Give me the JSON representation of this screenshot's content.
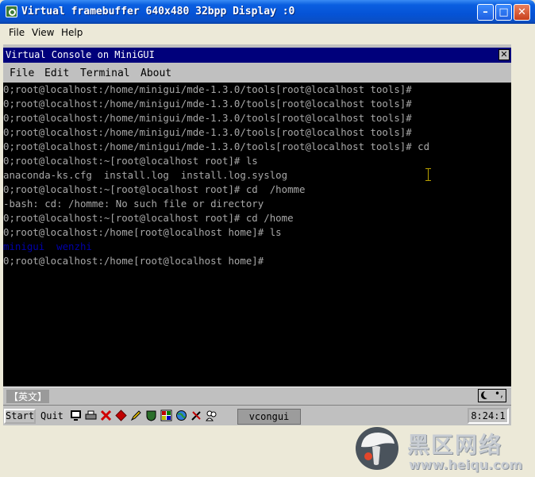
{
  "window": {
    "title": "Virtual framebuffer 640x480 32bpp Display :0",
    "minimize_glyph": "–",
    "maximize_glyph": "□",
    "close_glyph": "✕"
  },
  "menubar": {
    "items": [
      "File",
      "View",
      "Help"
    ]
  },
  "console": {
    "title": "Virtual Console on MiniGUI",
    "close_glyph": "✕",
    "menu": [
      "File",
      "Edit",
      "Terminal",
      "About"
    ],
    "lines": [
      "0;root@localhost:/home/minigui/mde-1.3.0/tools[root@localhost tools]#",
      "0;root@localhost:/home/minigui/mde-1.3.0/tools[root@localhost tools]#",
      "0;root@localhost:/home/minigui/mde-1.3.0/tools[root@localhost tools]#",
      "0;root@localhost:/home/minigui/mde-1.3.0/tools[root@localhost tools]#",
      "0;root@localhost:/home/minigui/mde-1.3.0/tools[root@localhost tools]# cd",
      "0;root@localhost:~[root@localhost root]# ls",
      "anaconda-ks.cfg  install.log  install.log.syslog",
      "0;root@localhost:~[root@localhost root]# cd  /homme",
      "-bash: cd: /homme: No such file or directory",
      "0;root@localhost:~[root@localhost root]# cd /home",
      "0;root@localhost:/home[root@localhost home]# ls",
      "minigui  wenzhi",
      "0;root@localhost:/home[root@localhost home]#"
    ],
    "dir_color": "#0000AA",
    "text_color": "#A8A8A8"
  },
  "ime": {
    "label": "【英文】",
    "dots_glyph": "•,"
  },
  "taskbar": {
    "start_label": "Start",
    "quit_label": "Quit",
    "task_label": "vcongui",
    "clock": "8:24:1"
  },
  "watermark": {
    "text": "黑区网络",
    "url": "www.heiqu.com"
  }
}
